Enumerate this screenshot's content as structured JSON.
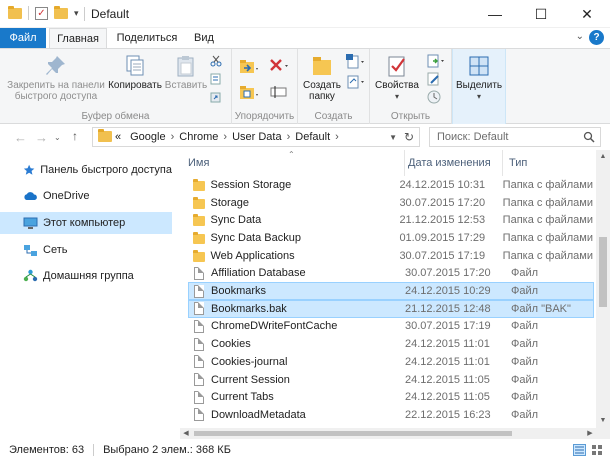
{
  "window": {
    "title": "Default",
    "minimize_glyph": "—",
    "maximize_glyph": "☐",
    "close_glyph": "✕"
  },
  "tabs": {
    "file": "Файл",
    "home": "Главная",
    "share": "Поделиться",
    "view": "Вид",
    "help": "?"
  },
  "ribbon": {
    "pin": "Закрепить на панели быстрого доступа",
    "copy": "Копировать",
    "paste": "Вставить",
    "clipboard_group": "Буфер обмена",
    "organize_group": "Упорядочить",
    "new_folder": "Создать папку",
    "create_group": "Создать",
    "properties": "Свойства",
    "open_group": "Открыть",
    "select": "Выделить"
  },
  "address": {
    "overflow": "«",
    "crumbs": [
      "Google",
      "Chrome",
      "User Data",
      "Default"
    ]
  },
  "search": {
    "placeholder": "Поиск: Default"
  },
  "navpane": {
    "items": [
      {
        "label": "Панель быстрого доступа",
        "icon": "star-icon"
      },
      {
        "label": "OneDrive",
        "icon": "cloud-icon"
      },
      {
        "label": "Этот компьютер",
        "icon": "computer-icon"
      },
      {
        "label": "Сеть",
        "icon": "network-icon"
      },
      {
        "label": "Домашняя группа",
        "icon": "homegroup-icon"
      }
    ]
  },
  "columns": {
    "name": "Имя",
    "date": "Дата изменения",
    "type": "Тип"
  },
  "files": [
    {
      "name": "Session Storage",
      "date": "24.12.2015 10:31",
      "type": "Папка с файлами",
      "kind": "folder"
    },
    {
      "name": "Storage",
      "date": "30.07.2015 17:20",
      "type": "Папка с файлами",
      "kind": "folder"
    },
    {
      "name": "Sync Data",
      "date": "21.12.2015 12:53",
      "type": "Папка с файлами",
      "kind": "folder"
    },
    {
      "name": "Sync Data Backup",
      "date": "01.09.2015 17:29",
      "type": "Папка с файлами",
      "kind": "folder"
    },
    {
      "name": "Web Applications",
      "date": "30.07.2015 17:19",
      "type": "Папка с файлами",
      "kind": "folder"
    },
    {
      "name": "Affiliation Database",
      "date": "30.07.2015 17:20",
      "type": "Файл",
      "kind": "file"
    },
    {
      "name": "Bookmarks",
      "date": "24.12.2015 10:29",
      "type": "Файл",
      "kind": "file",
      "selected": true
    },
    {
      "name": "Bookmarks.bak",
      "date": "21.12.2015 12:48",
      "type": "Файл \"BAK\"",
      "kind": "file",
      "selected": true
    },
    {
      "name": "ChromeDWriteFontCache",
      "date": "30.07.2015 17:19",
      "type": "Файл",
      "kind": "file"
    },
    {
      "name": "Cookies",
      "date": "24.12.2015 11:01",
      "type": "Файл",
      "kind": "file"
    },
    {
      "name": "Cookies-journal",
      "date": "24.12.2015 11:01",
      "type": "Файл",
      "kind": "file"
    },
    {
      "name": "Current Session",
      "date": "24.12.2015 11:05",
      "type": "Файл",
      "kind": "file"
    },
    {
      "name": "Current Tabs",
      "date": "24.12.2015 11:05",
      "type": "Файл",
      "kind": "file"
    },
    {
      "name": "DownloadMetadata",
      "date": "22.12.2015 16:23",
      "type": "Файл",
      "kind": "file"
    }
  ],
  "status": {
    "items": "Элементов: 63",
    "selected": "Выбрано 2 элем.: 368 КБ"
  }
}
